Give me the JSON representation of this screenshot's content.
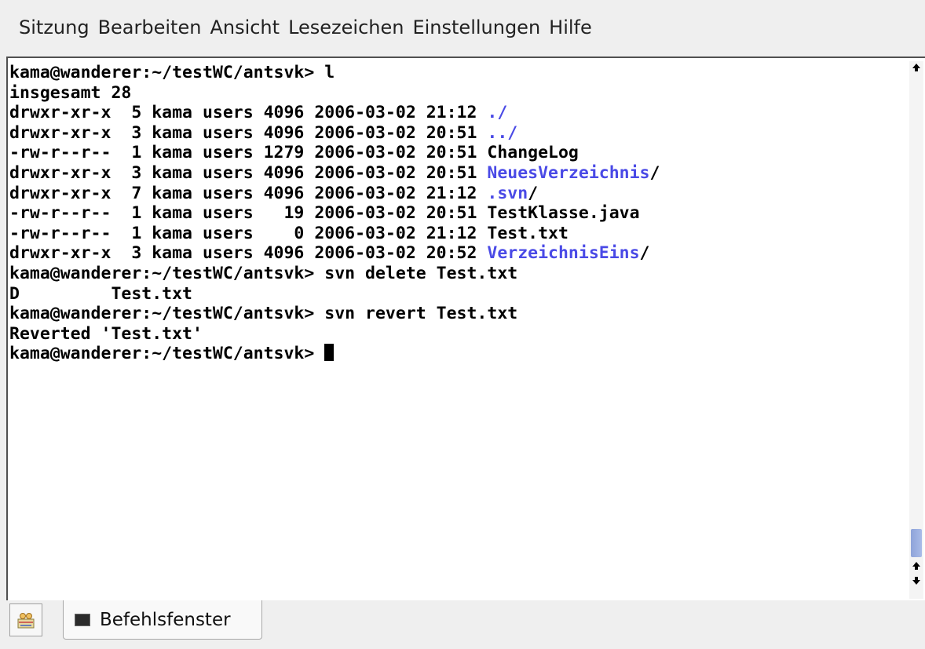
{
  "menu": {
    "items": [
      "Sitzung",
      "Bearbeiten",
      "Ansicht",
      "Lesezeichen",
      "Einstellungen",
      "Hilfe"
    ]
  },
  "terminal": {
    "lines": [
      {
        "segments": [
          {
            "text": "kama@wanderer:~/testWC/antsvk> l",
            "type": "text"
          }
        ]
      },
      {
        "segments": [
          {
            "text": "insgesamt 28",
            "type": "text"
          }
        ]
      },
      {
        "segments": [
          {
            "text": "drwxr-xr-x  5 kama users 4096 2006-03-02 21:12 ",
            "type": "text"
          },
          {
            "text": "./",
            "type": "dir"
          }
        ]
      },
      {
        "segments": [
          {
            "text": "drwxr-xr-x  3 kama users 4096 2006-03-02 20:51 ",
            "type": "text"
          },
          {
            "text": "../",
            "type": "dir"
          }
        ]
      },
      {
        "segments": [
          {
            "text": "-rw-r--r--  1 kama users 1279 2006-03-02 20:51 ChangeLog",
            "type": "text"
          }
        ]
      },
      {
        "segments": [
          {
            "text": "drwxr-xr-x  3 kama users 4096 2006-03-02 20:51 ",
            "type": "text"
          },
          {
            "text": "NeuesVerzeichnis",
            "type": "dir"
          },
          {
            "text": "/",
            "type": "text"
          }
        ]
      },
      {
        "segments": [
          {
            "text": "drwxr-xr-x  7 kama users 4096 2006-03-02 21:12 ",
            "type": "text"
          },
          {
            "text": ".svn",
            "type": "dir"
          },
          {
            "text": "/",
            "type": "text"
          }
        ]
      },
      {
        "segments": [
          {
            "text": "-rw-r--r--  1 kama users   19 2006-03-02 20:51 TestKlasse.java",
            "type": "text"
          }
        ]
      },
      {
        "segments": [
          {
            "text": "-rw-r--r--  1 kama users    0 2006-03-02 21:12 Test.txt",
            "type": "text"
          }
        ]
      },
      {
        "segments": [
          {
            "text": "drwxr-xr-x  3 kama users 4096 2006-03-02 20:52 ",
            "type": "text"
          },
          {
            "text": "VerzeichnisEins",
            "type": "dir"
          },
          {
            "text": "/",
            "type": "text"
          }
        ]
      },
      {
        "segments": [
          {
            "text": "kama@wanderer:~/testWC/antsvk> svn delete Test.txt",
            "type": "text"
          }
        ]
      },
      {
        "segments": [
          {
            "text": "D         Test.txt",
            "type": "text"
          }
        ]
      },
      {
        "segments": [
          {
            "text": "kama@wanderer:~/testWC/antsvk> svn revert Test.txt",
            "type": "text"
          }
        ]
      },
      {
        "segments": [
          {
            "text": "Reverted 'Test.txt'",
            "type": "text"
          }
        ]
      },
      {
        "segments": [
          {
            "text": "kama@wanderer:~/testWC/antsvk> ",
            "type": "text"
          },
          {
            "text": "",
            "type": "cursor"
          }
        ]
      }
    ],
    "colors": {
      "text": "#000000",
      "directory": "#4a4ae6",
      "background": "#ffffff"
    }
  },
  "scrollbar": {
    "up_icon": "arrow-up-icon",
    "down_icon": "arrow-down-icon"
  },
  "tabs": {
    "new_session_icon": "new-session-icon",
    "items": [
      {
        "label": "Befehlsfenster",
        "icon": "terminal-icon"
      }
    ]
  }
}
